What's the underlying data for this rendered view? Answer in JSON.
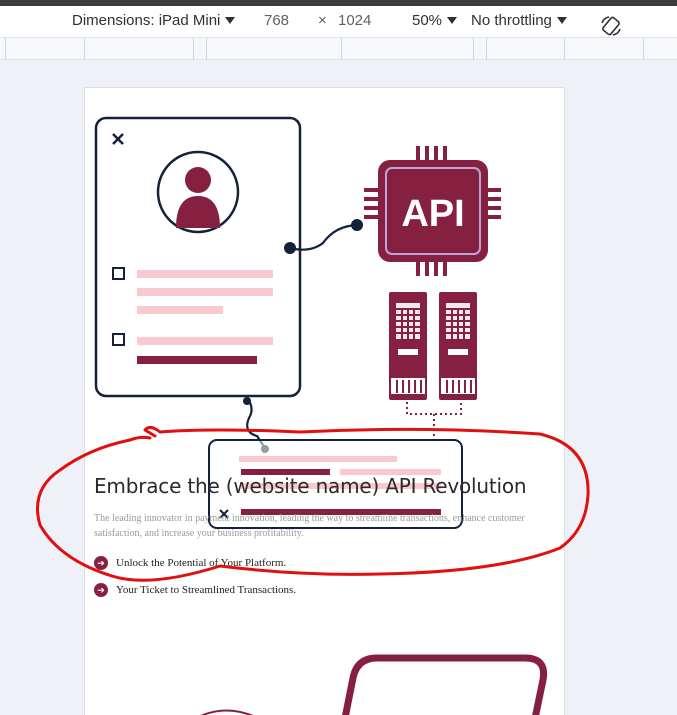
{
  "toolbar": {
    "dimensions_label": "Dimensions: iPad Mini",
    "width": "768",
    "times": "×",
    "height": "1024",
    "zoom": "50%",
    "throttling": "No throttling",
    "rotate_icon": "rotate-icon"
  },
  "page": {
    "illustration": {
      "api_label": "API",
      "close_icon": "close-icon"
    },
    "headline": "Embrace the (website name) API Revolution",
    "description": "The leading innovator in payment innovation, leading the way to streamline transactions, enhance customer satisfaction, and increase your business profitability.",
    "bullets": [
      {
        "icon": "arrow-circle-icon",
        "text": "Unlock the Potential of Your Platform."
      },
      {
        "icon": "arrow-circle-icon",
        "text": "Your Ticket to Streamlined Transactions."
      }
    ]
  },
  "colors": {
    "brand": "#862041",
    "navy": "#14213d",
    "pink": "#f9c9cf",
    "annotation": "#e01010"
  }
}
